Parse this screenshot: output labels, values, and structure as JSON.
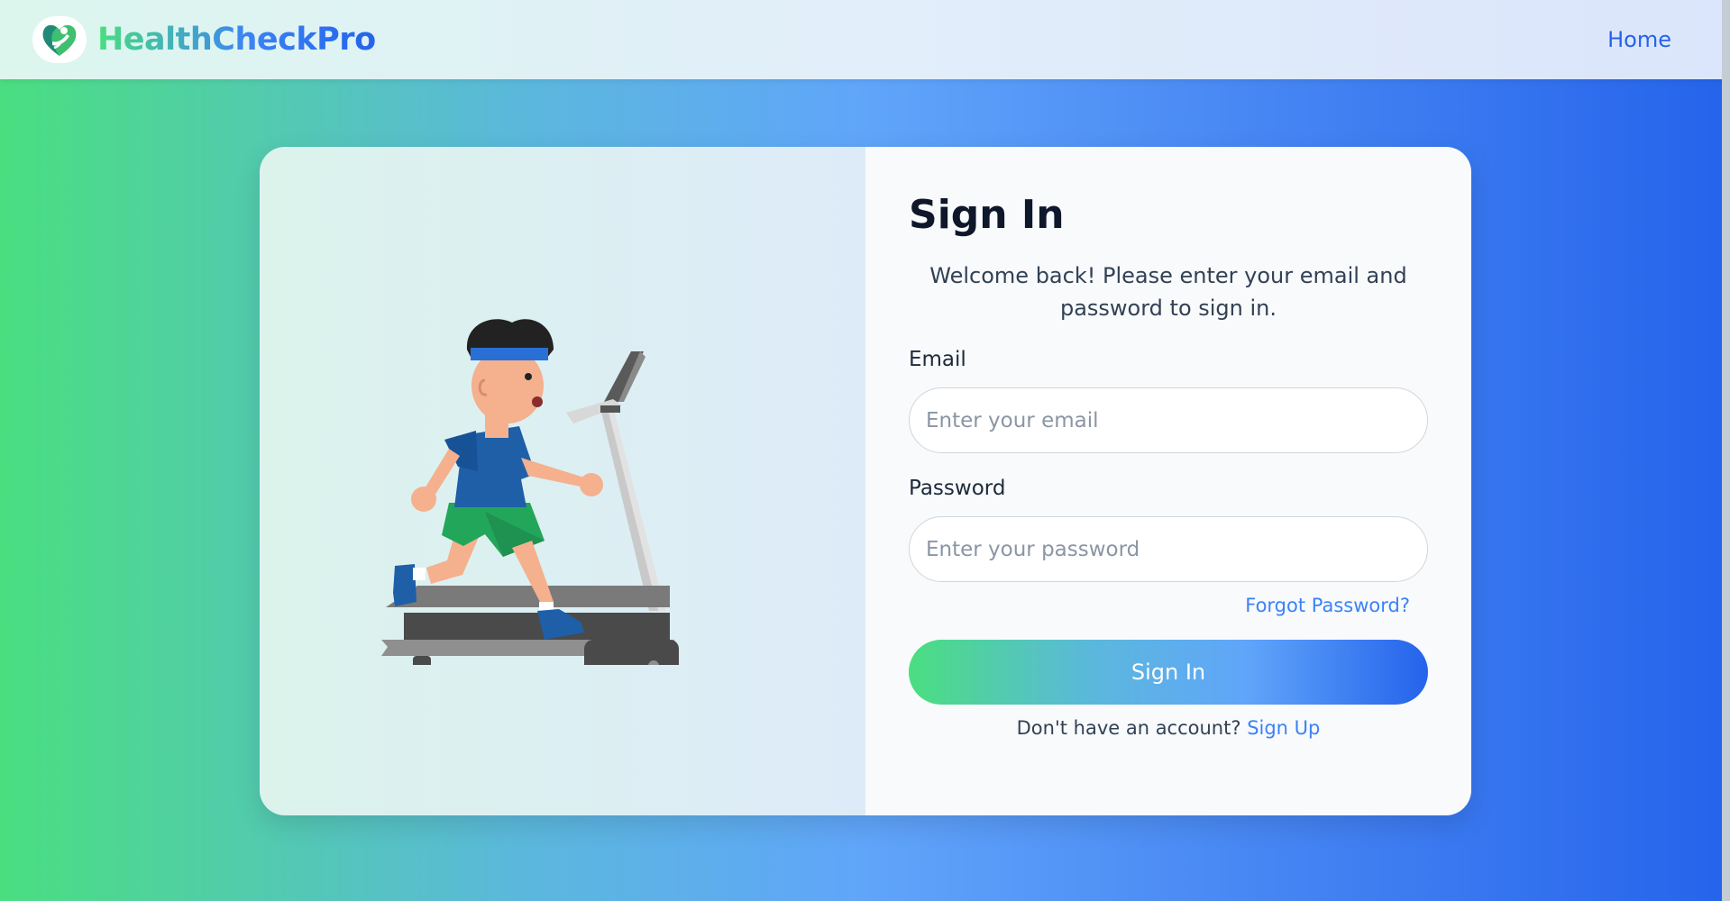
{
  "nav": {
    "brand": "HealthCheckPro",
    "home_label": "Home"
  },
  "login": {
    "title": "Sign In",
    "subtitle": "Welcome back! Please enter your email and password to sign in.",
    "email_label": "Email",
    "email_placeholder": "Enter your email",
    "password_label": "Password",
    "password_placeholder": "Enter your password",
    "forgot_label": "Forgot Password?",
    "submit_label": "Sign In",
    "signup_prompt": "Don't have an account?",
    "signup_link": "Sign Up"
  },
  "icons": {
    "logo": "heart-person-logo-icon",
    "illustration": "treadmill-runner-illustration"
  },
  "colors": {
    "gradient_start": "#4ade80",
    "gradient_mid": "#60a5fa",
    "gradient_end": "#2563eb",
    "link": "#3b82f6"
  }
}
